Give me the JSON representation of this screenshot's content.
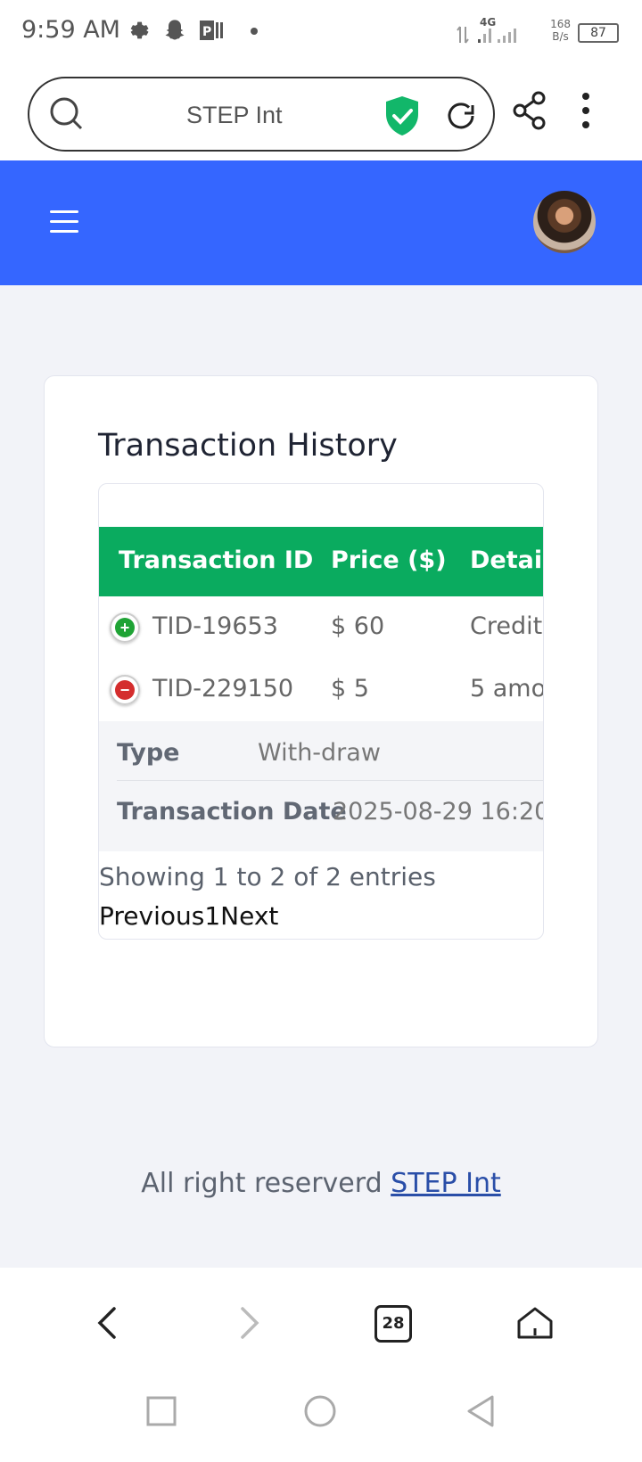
{
  "status_bar": {
    "time": "9:59 AM",
    "network": "4G",
    "speed_value": "168",
    "speed_unit": "B/s",
    "battery": "87"
  },
  "browser": {
    "url_text": "STEP Int"
  },
  "card": {
    "title": "Transaction History",
    "columns": [
      "Transaction ID",
      "Price ($)",
      "Detail"
    ],
    "rows": [
      {
        "type_icon": "plus",
        "id": "TID-19653",
        "price": "$ 60",
        "detail": "Credit"
      },
      {
        "type_icon": "minus",
        "id": "TID-229150",
        "price": "$ 5",
        "detail": "5 amo"
      }
    ],
    "expanded": {
      "type_label": "Type",
      "type_value": "With-draw",
      "date_label": "Transaction Date",
      "date_value": "2025-08-29 16:20"
    },
    "info": "Showing 1 to 2 of 2 entries",
    "pager": {
      "prev": "Previous",
      "page": "1",
      "next": "Next"
    }
  },
  "footer": {
    "text": "All right reserverd ",
    "link": "STEP Int"
  },
  "bottom_nav": {
    "tabs_count": "28"
  },
  "colors": {
    "header": "#3566ff",
    "table_head": "#0aab5f",
    "credit": "#1fa335",
    "debit": "#d42d2d"
  }
}
